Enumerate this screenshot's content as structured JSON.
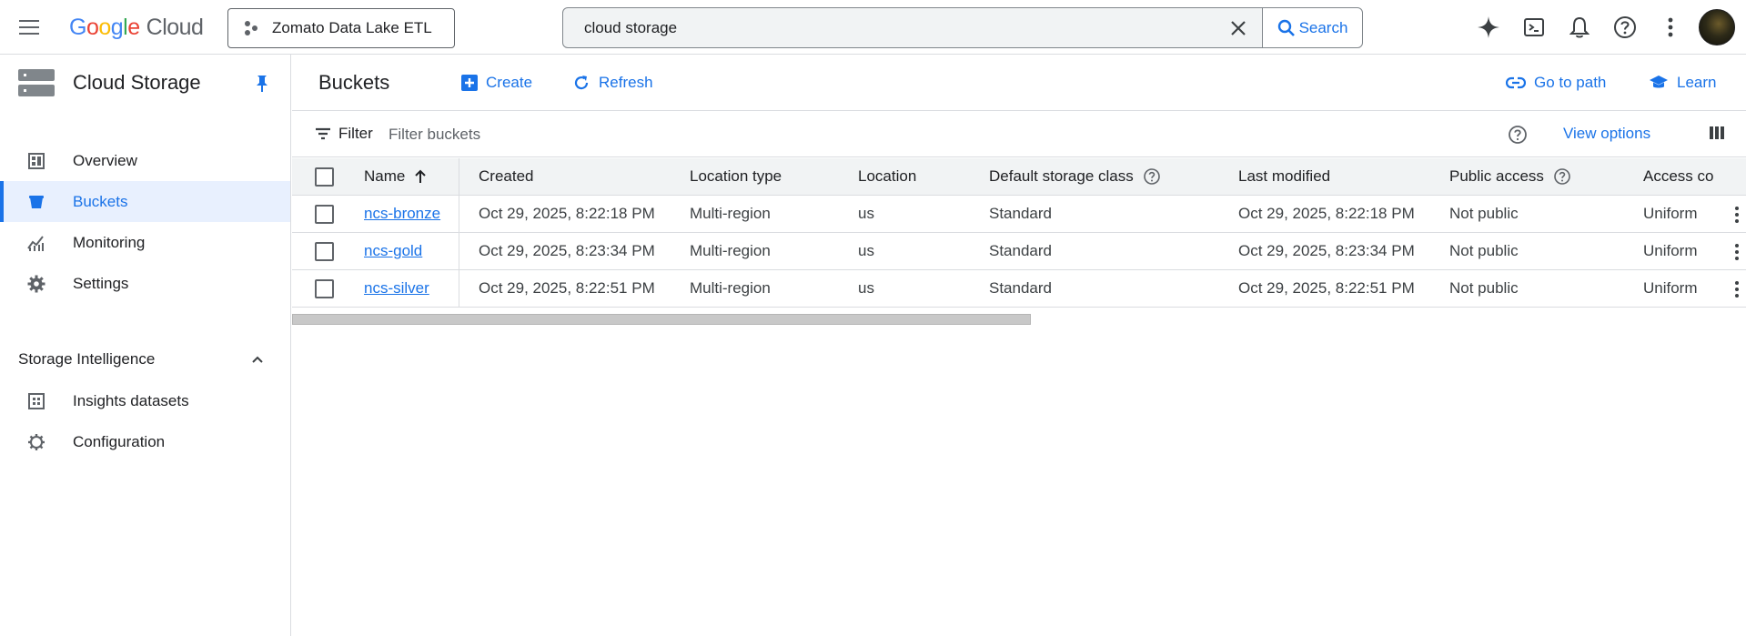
{
  "brand": {
    "letters": [
      "G",
      "o",
      "o",
      "g",
      "l",
      "e"
    ],
    "product": "Cloud"
  },
  "project": {
    "name": "Zomato Data Lake ETL"
  },
  "search": {
    "value": "cloud storage",
    "button_label": "Search"
  },
  "sidebar": {
    "title": "Cloud Storage",
    "items": [
      {
        "label": "Overview",
        "icon": "overview-icon"
      },
      {
        "label": "Buckets",
        "icon": "bucket-icon",
        "active": true
      },
      {
        "label": "Monitoring",
        "icon": "monitoring-icon"
      },
      {
        "label": "Settings",
        "icon": "settings-icon"
      }
    ],
    "section": {
      "label": "Storage Intelligence",
      "items": [
        {
          "label": "Insights datasets",
          "icon": "insights-icon"
        },
        {
          "label": "Configuration",
          "icon": "configuration-icon"
        }
      ]
    }
  },
  "page": {
    "title": "Buckets",
    "create_label": "Create",
    "refresh_label": "Refresh",
    "go_to_path_label": "Go to path",
    "learn_label": "Learn"
  },
  "filter": {
    "label": "Filter",
    "placeholder": "Filter buckets",
    "view_options_label": "View options"
  },
  "table": {
    "columns": {
      "name": "Name",
      "created": "Created",
      "location_type": "Location type",
      "location": "Location",
      "storage_class": "Default storage class",
      "last_modified": "Last modified",
      "public_access": "Public access",
      "access_control": "Access co"
    },
    "rows": [
      {
        "name": "ncs-bronze",
        "created": "Oct 29, 2025, 8:22:18 PM",
        "location_type": "Multi-region",
        "location": "us",
        "storage_class": "Standard",
        "last_modified": "Oct 29, 2025, 8:22:18 PM",
        "public_access": "Not public",
        "access_control": "Uniform"
      },
      {
        "name": "ncs-gold",
        "created": "Oct 29, 2025, 8:23:34 PM",
        "location_type": "Multi-region",
        "location": "us",
        "storage_class": "Standard",
        "last_modified": "Oct 29, 2025, 8:23:34 PM",
        "public_access": "Not public",
        "access_control": "Uniform"
      },
      {
        "name": "ncs-silver",
        "created": "Oct 29, 2025, 8:22:51 PM",
        "location_type": "Multi-region",
        "location": "us",
        "storage_class": "Standard",
        "last_modified": "Oct 29, 2025, 8:22:51 PM",
        "public_access": "Not public",
        "access_control": "Uniform"
      }
    ]
  },
  "colors": {
    "accent": "#1a73e8",
    "active_bg": "#e8f0fe",
    "header_bg": "#f1f3f4",
    "border": "#dadce0"
  }
}
